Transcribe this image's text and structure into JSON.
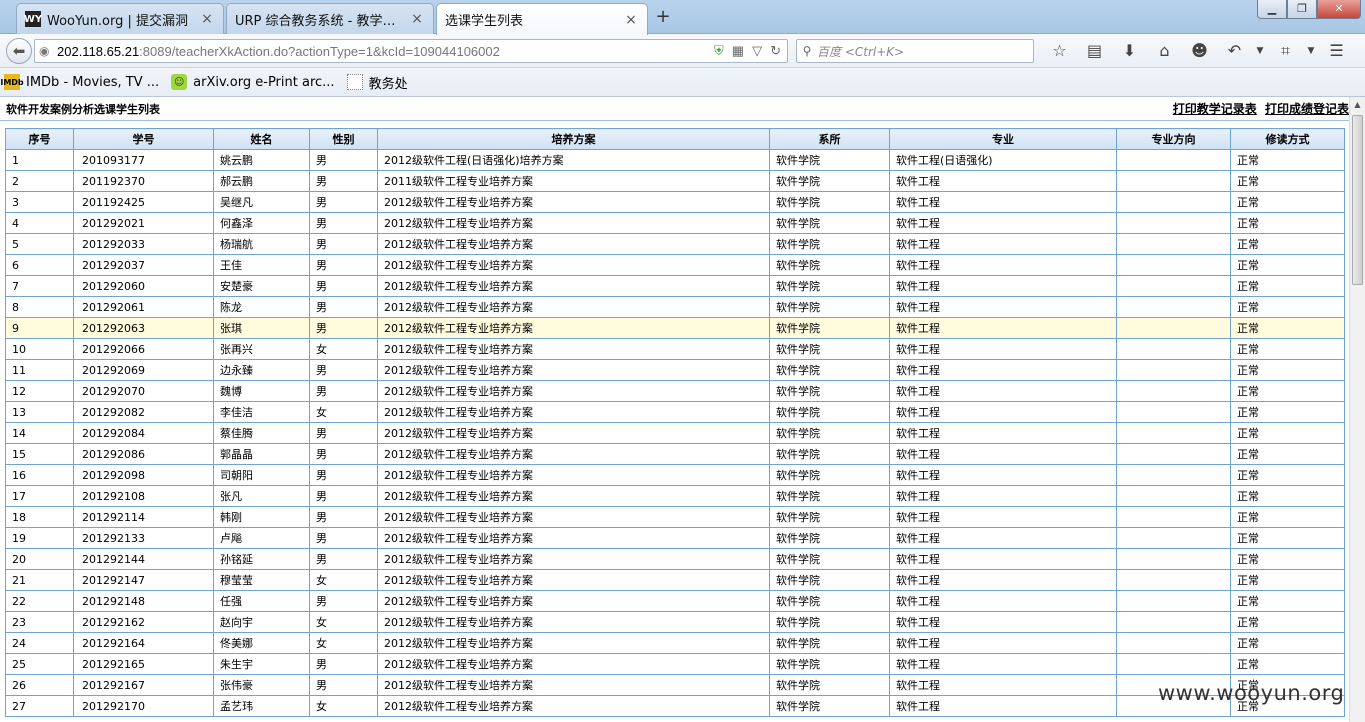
{
  "browser": {
    "tabs": [
      {
        "favicon": "WY",
        "title": "WooYun.org | 提交漏洞",
        "close": "×"
      },
      {
        "favicon": "",
        "title": "URP 综合教务系统 - 教学信息...",
        "close": "×"
      },
      {
        "favicon": "",
        "title": "选课学生列表",
        "close": "×"
      }
    ],
    "new_tab": "+",
    "url_host": "202.118.65.21",
    "url_path": ":8089/teacherXkAction.do?actionType=1&kcId=109044106002",
    "search_placeholder": "百度 <Ctrl+K>",
    "bookmarks": [
      {
        "icon_text": "IMDb",
        "label": "IMDb - Movies, TV ..."
      },
      {
        "icon_text": "☺",
        "label": "arXiv.org e-Print arc..."
      },
      {
        "icon_text": "",
        "label": "教务处"
      }
    ]
  },
  "page": {
    "title": "软件开发案例分析选课学生列表",
    "link_print_teaching": "打印教学记录表",
    "link_print_grades": "打印成绩登记表"
  },
  "table": {
    "headers": [
      "序号",
      "学号",
      "姓名",
      "性别",
      "培养方案",
      "系所",
      "专业",
      "专业方向",
      "修读方式"
    ],
    "highlight_row": 9,
    "rows": [
      [
        "1",
        "201093177",
        "姚云鹏",
        "男",
        "2012级软件工程(日语强化)培养方案",
        "软件学院",
        "软件工程(日语强化)",
        "",
        "正常"
      ],
      [
        "2",
        "201192370",
        "郝云鹏",
        "男",
        "2011级软件工程专业培养方案",
        "软件学院",
        "软件工程",
        "",
        "正常"
      ],
      [
        "3",
        "201192425",
        "吴继凡",
        "男",
        "2012级软件工程专业培养方案",
        "软件学院",
        "软件工程",
        "",
        "正常"
      ],
      [
        "4",
        "201292021",
        "何鑫泽",
        "男",
        "2012级软件工程专业培养方案",
        "软件学院",
        "软件工程",
        "",
        "正常"
      ],
      [
        "5",
        "201292033",
        "杨瑞航",
        "男",
        "2012级软件工程专业培养方案",
        "软件学院",
        "软件工程",
        "",
        "正常"
      ],
      [
        "6",
        "201292037",
        "王佳",
        "男",
        "2012级软件工程专业培养方案",
        "软件学院",
        "软件工程",
        "",
        "正常"
      ],
      [
        "7",
        "201292060",
        "安楚豪",
        "男",
        "2012级软件工程专业培养方案",
        "软件学院",
        "软件工程",
        "",
        "正常"
      ],
      [
        "8",
        "201292061",
        "陈龙",
        "男",
        "2012级软件工程专业培养方案",
        "软件学院",
        "软件工程",
        "",
        "正常"
      ],
      [
        "9",
        "201292063",
        "张琪",
        "男",
        "2012级软件工程专业培养方案",
        "软件学院",
        "软件工程",
        "",
        "正常"
      ],
      [
        "10",
        "201292066",
        "张再兴",
        "女",
        "2012级软件工程专业培养方案",
        "软件学院",
        "软件工程",
        "",
        "正常"
      ],
      [
        "11",
        "201292069",
        "边永臻",
        "男",
        "2012级软件工程专业培养方案",
        "软件学院",
        "软件工程",
        "",
        "正常"
      ],
      [
        "12",
        "201292070",
        "魏博",
        "男",
        "2012级软件工程专业培养方案",
        "软件学院",
        "软件工程",
        "",
        "正常"
      ],
      [
        "13",
        "201292082",
        "李佳洁",
        "女",
        "2012级软件工程专业培养方案",
        "软件学院",
        "软件工程",
        "",
        "正常"
      ],
      [
        "14",
        "201292084",
        "蔡佳腾",
        "男",
        "2012级软件工程专业培养方案",
        "软件学院",
        "软件工程",
        "",
        "正常"
      ],
      [
        "15",
        "201292086",
        "郭晶晶",
        "男",
        "2012级软件工程专业培养方案",
        "软件学院",
        "软件工程",
        "",
        "正常"
      ],
      [
        "16",
        "201292098",
        "司朝阳",
        "男",
        "2012级软件工程专业培养方案",
        "软件学院",
        "软件工程",
        "",
        "正常"
      ],
      [
        "17",
        "201292108",
        "张凡",
        "男",
        "2012级软件工程专业培养方案",
        "软件学院",
        "软件工程",
        "",
        "正常"
      ],
      [
        "18",
        "201292114",
        "韩刚",
        "男",
        "2012级软件工程专业培养方案",
        "软件学院",
        "软件工程",
        "",
        "正常"
      ],
      [
        "19",
        "201292133",
        "卢飚",
        "男",
        "2012级软件工程专业培养方案",
        "软件学院",
        "软件工程",
        "",
        "正常"
      ],
      [
        "20",
        "201292144",
        "孙铭延",
        "男",
        "2012级软件工程专业培养方案",
        "软件学院",
        "软件工程",
        "",
        "正常"
      ],
      [
        "21",
        "201292147",
        "穆莹莹",
        "女",
        "2012级软件工程专业培养方案",
        "软件学院",
        "软件工程",
        "",
        "正常"
      ],
      [
        "22",
        "201292148",
        "任强",
        "男",
        "2012级软件工程专业培养方案",
        "软件学院",
        "软件工程",
        "",
        "正常"
      ],
      [
        "23",
        "201292162",
        "赵向宇",
        "女",
        "2012级软件工程专业培养方案",
        "软件学院",
        "软件工程",
        "",
        "正常"
      ],
      [
        "24",
        "201292164",
        "佟美娜",
        "女",
        "2012级软件工程专业培养方案",
        "软件学院",
        "软件工程",
        "",
        "正常"
      ],
      [
        "25",
        "201292165",
        "朱生宇",
        "男",
        "2012级软件工程专业培养方案",
        "软件学院",
        "软件工程",
        "",
        "正常"
      ],
      [
        "26",
        "201292167",
        "张伟豪",
        "男",
        "2012级软件工程专业培养方案",
        "软件学院",
        "软件工程",
        "",
        "正常"
      ],
      [
        "27",
        "201292170",
        "孟艺玮",
        "女",
        "2012级软件工程专业培养方案",
        "软件学院",
        "软件工程",
        "",
        "正常"
      ]
    ]
  },
  "watermark": "www.wooyun.org",
  "colors": {
    "grid_border": "#6fa3d2",
    "header_bg": "#cfe1f3",
    "highlight_row": "#fffbdc"
  }
}
